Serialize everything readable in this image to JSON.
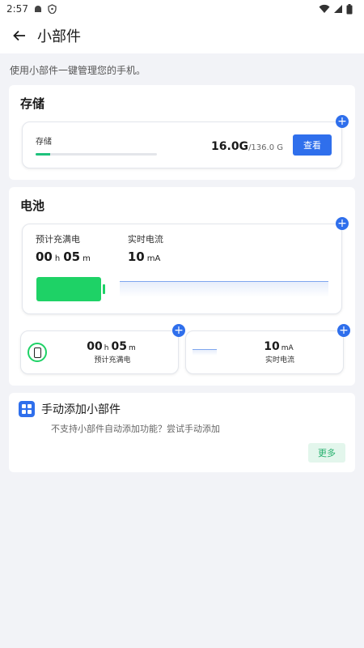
{
  "status_bar": {
    "time": "2:57"
  },
  "app_bar": {
    "title": "小部件"
  },
  "intro": "使用小部件一键管理您的手机。",
  "storage": {
    "section_title": "存储",
    "widget_label": "存储",
    "used": "16.0G",
    "total": "/136.0 G",
    "used_fraction": 0.12,
    "view_label": "查看",
    "add_symbol": "+"
  },
  "battery": {
    "section_title": "电池",
    "charge_label": "预计充满电",
    "hours": "00",
    "hours_unit": "h",
    "minutes": "05",
    "minutes_unit": "m",
    "current_label": "实时电流",
    "current_value": "10",
    "current_unit": "mA",
    "add_symbol": "+"
  },
  "manual": {
    "title": "手动添加小部件",
    "description": "不支持小部件自动添加功能？尝试手动添加",
    "more_label": "更多"
  },
  "colors": {
    "accent": "#2f6fec",
    "battery_green": "#1ed266",
    "storage_green": "#1ec27c"
  }
}
